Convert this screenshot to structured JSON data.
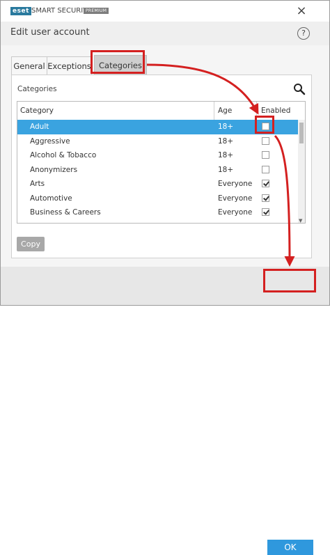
{
  "window": {
    "logo": "eset",
    "brand": "SMART SECURITY",
    "edition": "PREMIUM",
    "close_icon": "×"
  },
  "dialog": {
    "title": "Edit user account",
    "help_icon": "?"
  },
  "tabs": [
    {
      "label": "General",
      "selected": false
    },
    {
      "label": "Exceptions",
      "selected": false
    },
    {
      "label": "Categories",
      "selected": true
    }
  ],
  "panel": {
    "label": "Categories",
    "search_icon": "magnifier"
  },
  "table": {
    "columns": [
      "Category",
      "Age",
      "Enabled"
    ],
    "rows": [
      {
        "category": "Adult",
        "age": "18+",
        "enabled": false,
        "selected": true
      },
      {
        "category": "Aggressive",
        "age": "18+",
        "enabled": false,
        "selected": false
      },
      {
        "category": "Alcohol & Tobacco",
        "age": "18+",
        "enabled": false,
        "selected": false
      },
      {
        "category": "Anonymizers",
        "age": "18+",
        "enabled": false,
        "selected": false
      },
      {
        "category": "Arts",
        "age": "Everyone",
        "enabled": true,
        "selected": false
      },
      {
        "category": "Automotive",
        "age": "Everyone",
        "enabled": true,
        "selected": false
      },
      {
        "category": "Business & Careers",
        "age": "Everyone",
        "enabled": true,
        "selected": false
      }
    ]
  },
  "buttons": {
    "copy": "Copy",
    "ok": "OK"
  },
  "colors": {
    "selection": "#3aa3e0",
    "ok_button": "#2f98dd",
    "annotation": "#d42020",
    "logo_bg": "#2a7a9e"
  }
}
